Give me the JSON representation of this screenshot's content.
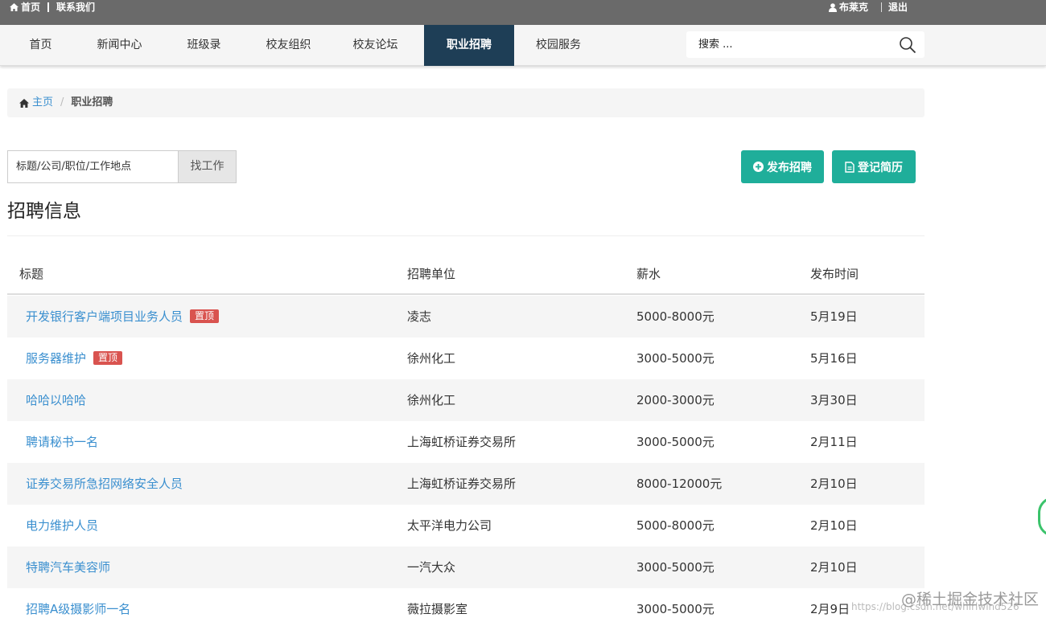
{
  "topbar": {
    "home": "首页",
    "contact": "联系我们",
    "user": "布莱克",
    "logout": "退出"
  },
  "nav": {
    "items": [
      "首页",
      "新闻中心",
      "班级录",
      "校友组织",
      "校友论坛",
      "职业招聘",
      "校园服务"
    ],
    "active": "职业招聘",
    "search_placeholder": "搜索 ..."
  },
  "breadcrumb": {
    "home": "主页",
    "current": "职业招聘"
  },
  "jobsearch": {
    "placeholder": "标题/公司/职位/工作地点",
    "button": "找工作"
  },
  "actions": {
    "post_job": "发布招聘",
    "register_resume": "登记简历"
  },
  "section_title": "招聘信息",
  "table": {
    "headers": [
      "标题",
      "招聘单位",
      "薪水",
      "发布时间"
    ],
    "rows": [
      {
        "title": "开发银行客户端项目业务人员",
        "badge": "置顶",
        "company": "凌志",
        "salary": "5000-8000元",
        "date": "5月19日"
      },
      {
        "title": "服务器维护",
        "badge": "置顶",
        "company": "徐州化工",
        "salary": "3000-5000元",
        "date": "5月16日"
      },
      {
        "title": "哈哈以哈哈",
        "badge": "",
        "company": "徐州化工",
        "salary": "2000-3000元",
        "date": "3月30日"
      },
      {
        "title": "聘请秘书一名",
        "badge": "",
        "company": "上海虹桥证券交易所",
        "salary": "3000-5000元",
        "date": "2月11日"
      },
      {
        "title": "证券交易所急招网络安全人员",
        "badge": "",
        "company": "上海虹桥证券交易所",
        "salary": "8000-12000元",
        "date": "2月10日"
      },
      {
        "title": "电力维护人员",
        "badge": "",
        "company": "太平洋电力公司",
        "salary": "5000-8000元",
        "date": "2月10日"
      },
      {
        "title": "特聘汽车美容师",
        "badge": "",
        "company": "一汽大众",
        "salary": "3000-5000元",
        "date": "2月10日"
      },
      {
        "title": "招聘A级摄影师一名",
        "badge": "",
        "company": "薇拉摄影室",
        "salary": "3000-5000元",
        "date": "2月9日"
      }
    ]
  },
  "watermark": {
    "main": "@稀土掘金技术社区",
    "sub": "https://blog.csdn.net/whirlwind526"
  },
  "icons": {
    "home": "home-icon",
    "user": "user-icon",
    "search": "search-icon",
    "plus_circle": "plus-circle-icon",
    "file": "file-icon"
  },
  "colors": {
    "topbar": "#6a6a6a",
    "nav_active": "#1e3e56",
    "teal": "#1fae9a",
    "link": "#3a8fcf",
    "badge": "#d9534f"
  }
}
